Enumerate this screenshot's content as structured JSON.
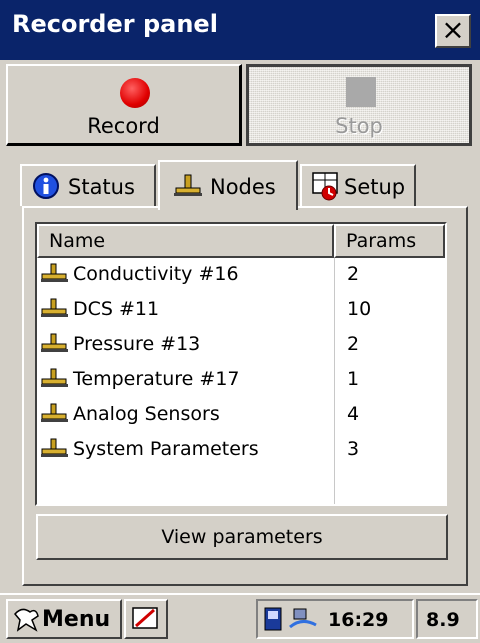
{
  "window": {
    "title": "Recorder panel",
    "close_glyph": "×"
  },
  "controls": {
    "record_label": "Record",
    "stop_label": "Stop"
  },
  "tabs": [
    {
      "label": "Status",
      "icon": "info-icon"
    },
    {
      "label": "Nodes",
      "icon": "node-icon",
      "active": true
    },
    {
      "label": "Setup",
      "icon": "setup-icon"
    }
  ],
  "table": {
    "headers": {
      "name": "Name",
      "params": "Params"
    },
    "rows": [
      {
        "name": "Conductivity #16",
        "params": "2"
      },
      {
        "name": "DCS #11",
        "params": "10"
      },
      {
        "name": "Pressure #13",
        "params": "2"
      },
      {
        "name": "Temperature #17",
        "params": "1"
      },
      {
        "name": "Analog Sensors",
        "params": "4"
      },
      {
        "name": "System Parameters",
        "params": "3"
      }
    ]
  },
  "view_button_label": "View parameters",
  "taskbar": {
    "menu_label": "Menu",
    "time": "16:29",
    "extra": "8.9"
  },
  "colors": {
    "title_bg": "#0a246a",
    "face": "#d4d0c8",
    "record_red": "#e00000"
  }
}
